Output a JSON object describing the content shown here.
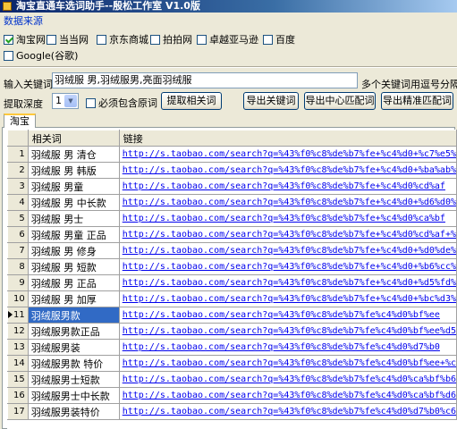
{
  "window": {
    "title": "淘宝直通车选词助手--殷松工作室 V1.0版"
  },
  "source": {
    "label": "数据来源",
    "options": [
      {
        "label": "淘宝网",
        "checked": true
      },
      {
        "label": "当当网",
        "checked": false
      },
      {
        "label": "京东商城",
        "checked": false
      },
      {
        "label": "拍拍网",
        "checked": false
      },
      {
        "label": "卓越亚马逊",
        "checked": false
      },
      {
        "label": "百度",
        "checked": false
      },
      {
        "label": "Google(谷歌)",
        "checked": false
      }
    ]
  },
  "keyword": {
    "label": "输入关键词",
    "value": "羽绒服 男,羽绒服男,亮面羽绒服",
    "hint": "多个关键词用逗号分隔"
  },
  "depth": {
    "label": "提取深度",
    "value": "1",
    "must_include_label": "必须包含原词",
    "must_include_checked": false
  },
  "buttons": {
    "extract": "提取相关词",
    "export_keywords": "导出关键词",
    "export_center": "导出中心匹配词",
    "export_exact": "导出精准匹配词"
  },
  "tabs": [
    {
      "label": "淘宝",
      "active": true
    }
  ],
  "grid": {
    "columns": [
      "相关词",
      "链接"
    ],
    "selected_row": 11,
    "rows": [
      {
        "n": "1",
        "kw": "羽绒服 男 清仓",
        "link": "http://s.taobao.com/search?q=%43%f0%c8%de%b7%fe+%c4%d0+%c7%e5%"
      },
      {
        "n": "2",
        "kw": "羽绒服 男 韩版",
        "link": "http://s.taobao.com/search?q=%43%f0%c8%de%b7%fe+%c4%d0+%ba%ab%"
      },
      {
        "n": "3",
        "kw": "羽绒服 男童",
        "link": "http://s.taobao.com/search?q=%43%f0%c8%de%b7%fe+%c4%d0%cd%af"
      },
      {
        "n": "4",
        "kw": "羽绒服 男 中长款",
        "link": "http://s.taobao.com/search?q=%43%f0%c8%de%b7%fe+%c4%d0+%d6%d0%"
      },
      {
        "n": "5",
        "kw": "羽绒服 男士",
        "link": "http://s.taobao.com/search?q=%43%f0%c8%de%b7%fe+%c4%d0%ca%bf"
      },
      {
        "n": "6",
        "kw": "羽绒服 男童 正品",
        "link": "http://s.taobao.com/search?q=%43%f0%c8%de%b7%fe+%c4%d0%cd%af+%"
      },
      {
        "n": "7",
        "kw": "羽绒服 男 修身",
        "link": "http://s.taobao.com/search?q=%43%f0%c8%de%b7%fe+%c4%d0+%d0%de%"
      },
      {
        "n": "8",
        "kw": "羽绒服 男 短款",
        "link": "http://s.taobao.com/search?q=%43%f0%c8%de%b7%fe+%c4%d0+%b6%cc%"
      },
      {
        "n": "9",
        "kw": "羽绒服 男 正品",
        "link": "http://s.taobao.com/search?q=%43%f0%c8%de%b7%fe+%c4%d0+%d5%fd%"
      },
      {
        "n": "10",
        "kw": "羽绒服 男 加厚",
        "link": "http://s.taobao.com/search?q=%43%f0%c8%de%b7%fe+%c4%d0+%bc%d3%"
      },
      {
        "n": "11",
        "kw": "羽绒服男款",
        "link": "http://s.taobao.com/search?q=%43%f0%c8%de%b7%fe%c4%d0%bf%ee"
      },
      {
        "n": "12",
        "kw": "羽绒服男款正品",
        "link": "http://s.taobao.com/search?q=%43%f0%c8%de%b7%fe%c4%d0%bf%ee%d5"
      },
      {
        "n": "13",
        "kw": "羽绒服男装",
        "link": "http://s.taobao.com/search?q=%43%f0%c8%de%b7%fe%c4%d0%d7%b0"
      },
      {
        "n": "14",
        "kw": "羽绒服男款 特价",
        "link": "http://s.taobao.com/search?q=%43%f0%c8%de%b7%fe%c4%d0%bf%ee+%c"
      },
      {
        "n": "15",
        "kw": "羽绒服男士短款",
        "link": "http://s.taobao.com/search?q=%43%f0%c8%de%b7%fe%c4%d0%ca%bf%b6"
      },
      {
        "n": "16",
        "kw": "羽绒服男士中长款",
        "link": "http://s.taobao.com/search?q=%43%f0%c8%de%b7%fe%c4%d0%ca%bf%d6"
      },
      {
        "n": "17",
        "kw": "羽绒服男装特价",
        "link": "http://s.taobao.com/search?q=%43%f0%c8%de%b7%fe%c4%d0%d7%b0%c6"
      }
    ]
  }
}
